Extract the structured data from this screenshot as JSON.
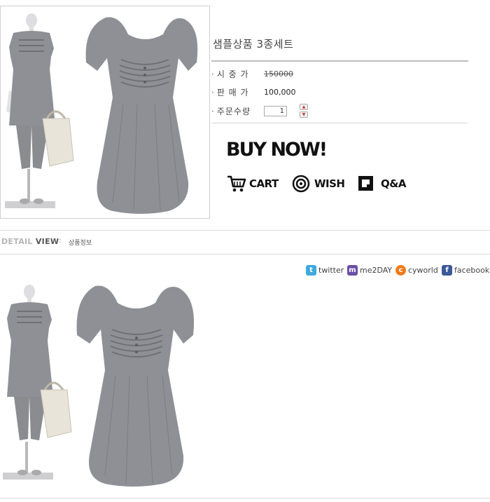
{
  "product": {
    "title": "샘플상품 3종세트",
    "market_price_label": "시 중 가",
    "market_price": "150000",
    "sale_price_label": "판 매 가",
    "sale_price": "100,000",
    "qty_label": "주문수량",
    "qty_value": "1",
    "qty_up": "▲",
    "qty_down": "▼"
  },
  "actions": {
    "buy_now": "BUY NOW!",
    "cart": "CART",
    "wish": "WISH",
    "qna": "Q&A"
  },
  "detail": {
    "label_part1": "DETAIL",
    "label_part2": "VIEW",
    "colon": ":",
    "sub": "상품정보"
  },
  "share": {
    "twitter": "twitter",
    "me2day": "me2DAY",
    "cyworld": "cyworld",
    "facebook": "facebook"
  },
  "colors": {
    "garment": "#8f9096",
    "twitter": "#3fa9dd",
    "me2day": "#6b4fa8",
    "cyworld": "#f07a1c",
    "facebook": "#3b5998"
  }
}
